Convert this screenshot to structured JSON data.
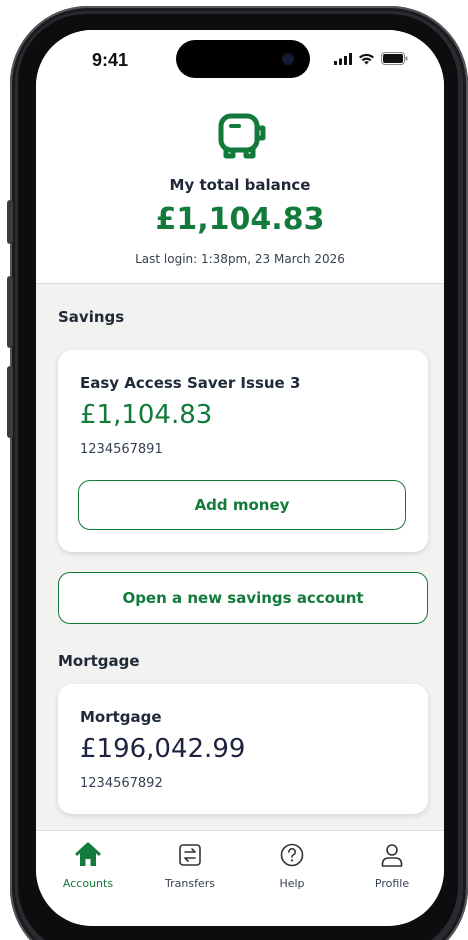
{
  "status_bar": {
    "time": "9:41"
  },
  "header": {
    "balance_label": "My total balance",
    "balance_value": "£1,104.83",
    "last_login": "Last login: 1:38pm, 23 March 2026",
    "icon": "piggy-bank-icon"
  },
  "savings": {
    "section_title": "Savings",
    "account": {
      "name": "Easy Access Saver Issue 3",
      "amount": "£1,104.83",
      "number": "1234567891",
      "add_money_label": "Add money"
    },
    "open_account_label": "Open a new savings account"
  },
  "mortgage": {
    "section_title": "Mortgage",
    "account": {
      "name": "Mortgage",
      "amount": "£196,042.99",
      "number": "1234567892"
    }
  },
  "bottom_nav": {
    "items": [
      {
        "label": "Accounts",
        "icon": "home-icon",
        "active": true
      },
      {
        "label": "Transfers",
        "icon": "transfer-icon",
        "active": false
      },
      {
        "label": "Help",
        "icon": "help-icon",
        "active": false
      },
      {
        "label": "Profile",
        "icon": "profile-icon",
        "active": false
      }
    ]
  },
  "colors": {
    "brand_green": "#127a3a",
    "background": "#f2f2f0",
    "text_dark": "#1f2937"
  }
}
